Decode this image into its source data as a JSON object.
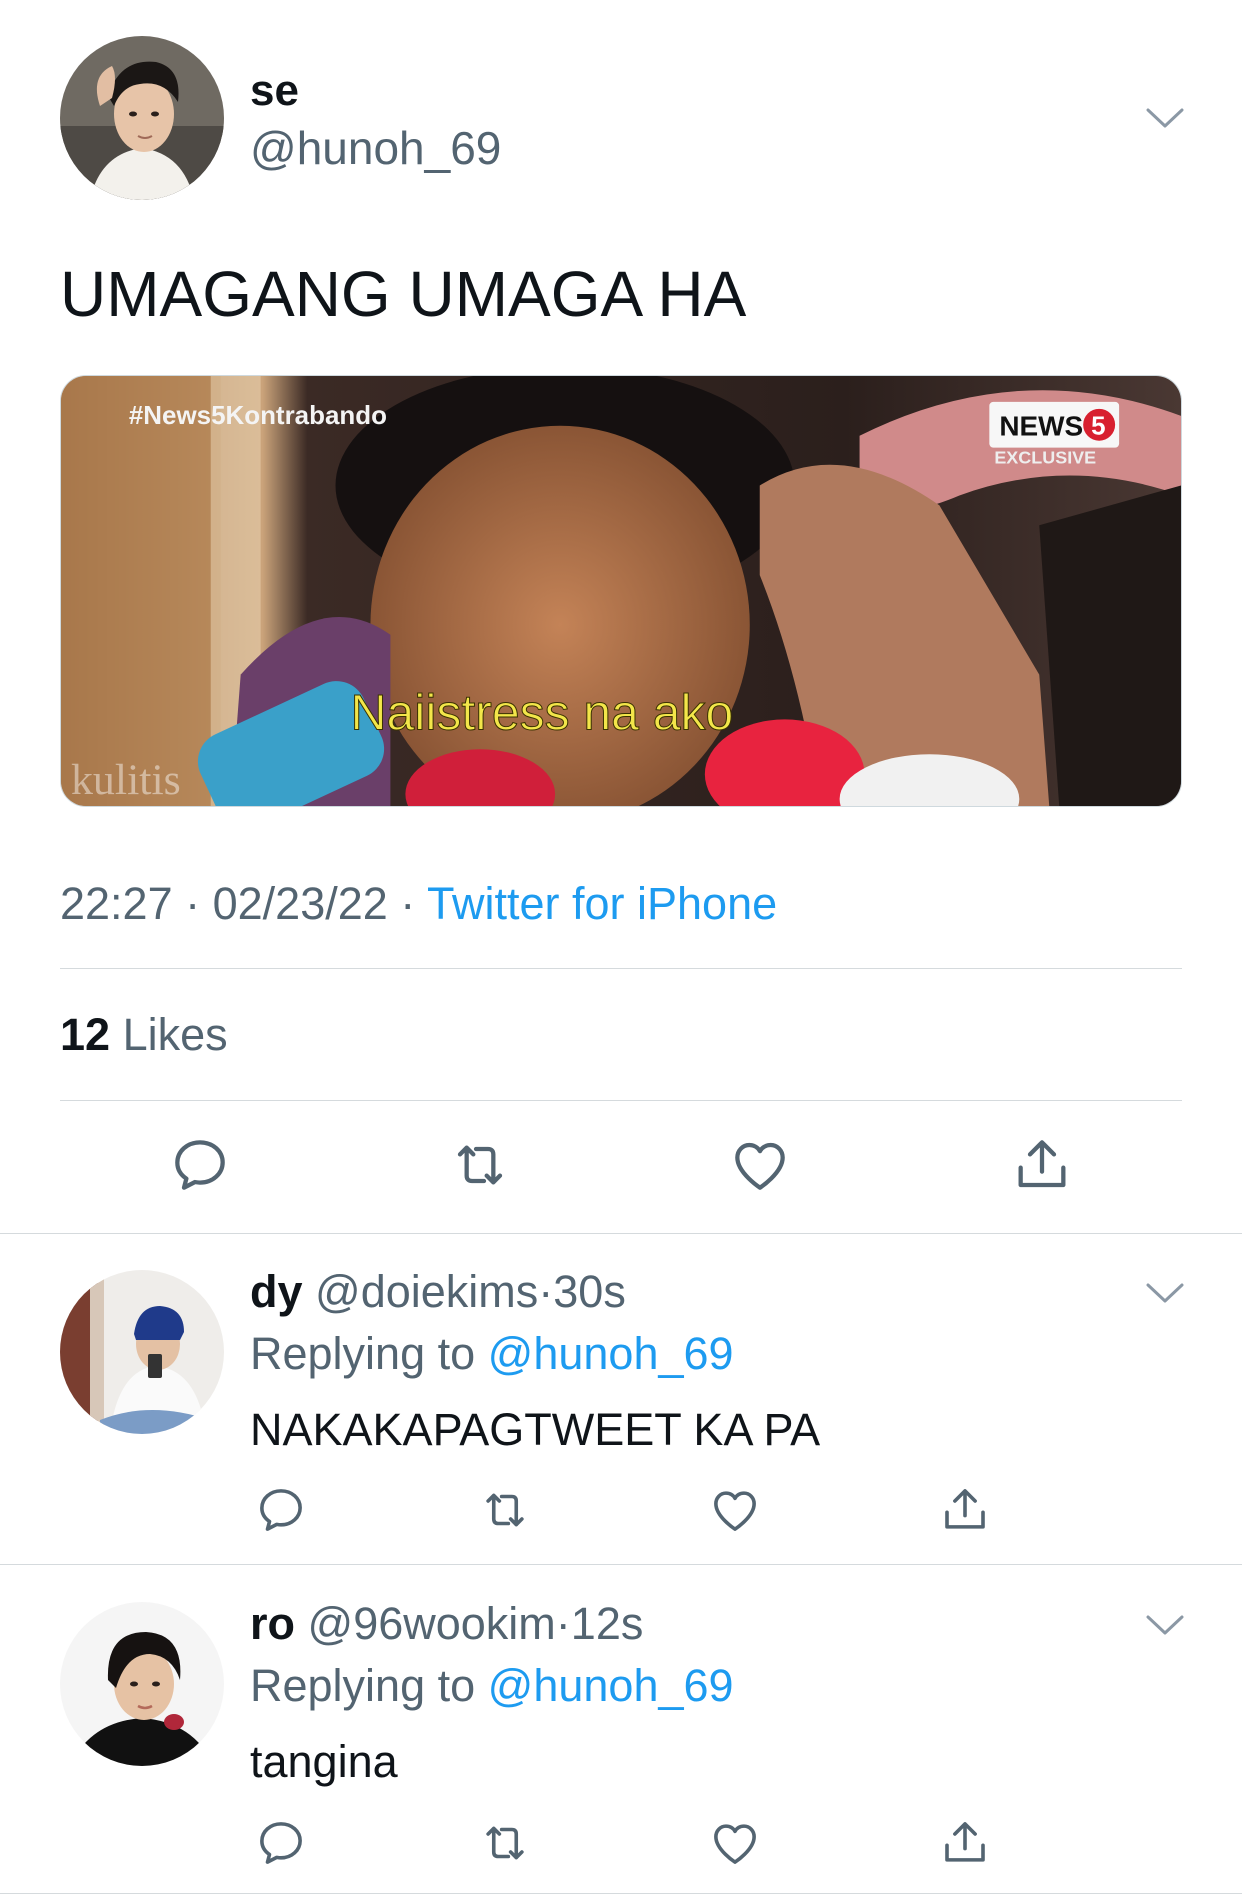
{
  "tweet": {
    "name": "se",
    "handle": "@hunoh_69",
    "text": "UMAGANG UMAGA HA",
    "media": {
      "hashtag": "#News5Kontrabando",
      "badge": "NEWS",
      "badge_num": "5",
      "badge_sub": "EXCLUSIVE",
      "caption": "Naiistress na ako",
      "watermark": "kulitis"
    },
    "time": "22:27",
    "date": "02/23/22",
    "source": "Twitter for iPhone",
    "likes_count": "12",
    "likes_label": "Likes"
  },
  "replies": [
    {
      "name": "dy",
      "handle": "@doiekims",
      "time": "30s",
      "replying_prefix": "Replying to",
      "replying_to": "@hunoh_69",
      "text": "NAKAKAPAGTWEET KA PA"
    },
    {
      "name": "ro",
      "handle": "@96wookim",
      "time": "12s",
      "replying_prefix": "Replying to",
      "replying_to": "@hunoh_69",
      "text": "tangina"
    }
  ],
  "icons": {
    "reply": "reply-icon",
    "retweet": "retweet-icon",
    "like": "heart-icon",
    "share": "share-icon",
    "more": "chevron-down-icon"
  },
  "colors": {
    "accent": "#1d9bf0",
    "secondary_text": "#536471",
    "primary_text": "#0f1419",
    "divider": "#d5dadd"
  }
}
